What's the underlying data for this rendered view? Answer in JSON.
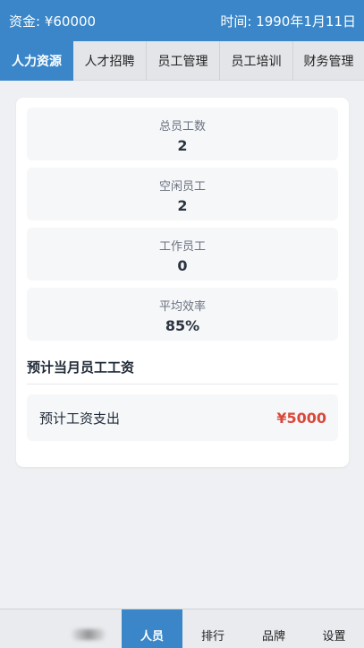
{
  "status": {
    "funds": "资金: ¥60000",
    "time": "时间: 1990年1月11日"
  },
  "tabs": [
    {
      "label": "人力资源",
      "active": true
    },
    {
      "label": "人才招聘",
      "active": false
    },
    {
      "label": "员工管理",
      "active": false
    },
    {
      "label": "员工培训",
      "active": false
    },
    {
      "label": "财务管理",
      "active": false
    }
  ],
  "stats": [
    {
      "label": "总员工数",
      "value": "2"
    },
    {
      "label": "空闲员工",
      "value": "2"
    },
    {
      "label": "工作员工",
      "value": "0"
    },
    {
      "label": "平均效率",
      "value": "85%"
    }
  ],
  "salary": {
    "section_title": "预计当月员工工资",
    "label": "预计工资支出",
    "value": "¥5000"
  },
  "bottom_nav": [
    {
      "label": "人员",
      "active": true
    },
    {
      "label": "排行",
      "active": false
    },
    {
      "label": "品牌",
      "active": false
    },
    {
      "label": "设置",
      "active": false
    }
  ],
  "colors": {
    "accent": "#3a86c8",
    "salary_red": "#d9493b"
  }
}
